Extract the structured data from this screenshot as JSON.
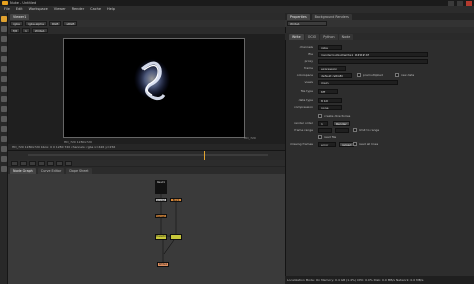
{
  "window": {
    "title": "Nuke - Untitled"
  },
  "menu": [
    "File",
    "Edit",
    "Workspace",
    "Viewer",
    "Render",
    "Cache",
    "Help"
  ],
  "viewer": {
    "tab_label": "Viewer1",
    "channels": "rgba",
    "alpha": "rgba.alpha",
    "colorspace": "RGB",
    "gain_label": "sRGB",
    "zoom": "f/8",
    "frame_field": "1",
    "node": "Write1",
    "format_label": "HD_720",
    "format_label_bottom": "HD_720 1280x720",
    "info_text": "HD_720 1280x720  bbox: 0 0 1280 720 channels: rgba  x=426 y=256"
  },
  "node_graph": {
    "tabs": [
      "Node Graph",
      "Curve Editor",
      "Dope Sheet"
    ],
    "nodes": [
      "Read1",
      "Grade1",
      "Blur1",
      "Merge1",
      "Transform1",
      "Write1"
    ]
  },
  "properties": {
    "tabs": [
      "Properties",
      "Background Renders"
    ],
    "node_name": "Write1",
    "knob_tabs": [
      "Write",
      "OCIO",
      "Python",
      "Node"
    ],
    "rows": [
      {
        "label": "channels",
        "value": "rgba"
      },
      {
        "label": "file",
        "value": "/render/output/write1_####.tif"
      },
      {
        "label": "proxy",
        "value": ""
      },
      {
        "label": "frame",
        "value": "expression"
      },
      {
        "label": "colorspace",
        "value": "default (sRGB)"
      },
      {
        "label": "views",
        "value": "main"
      },
      {
        "label": "file type",
        "value": "tiff"
      },
      {
        "label": "data type",
        "value": "8 bit"
      },
      {
        "label": "compression",
        "value": "none"
      }
    ],
    "raw_label": "raw data",
    "premultiplied_label": "premultiplied",
    "create_dirs_label": "create directories",
    "render_order_label": "render order",
    "render_order_value": "1",
    "render_button": "Render",
    "frame_range_label": "frame range",
    "limit_label": "limit to range",
    "read_file_label": "read file",
    "missing_frames_label": "missing frames",
    "missing_frames_value": "error",
    "reload_label": "reload",
    "read_all_lines_label": "read all lines"
  },
  "status": {
    "text": "Localization Mode: On  Memory: 0.4 GB (1.4%)  CPU: 0.0%  Disk: 0.0 MB/s  Network: 0.0 MB/s"
  },
  "colors": {
    "accent": "#e0a230",
    "read_node": "#cfcfcf",
    "grade_node": "#d98a3b",
    "merge_node": "#c7c73a",
    "write_node": "#e09060"
  }
}
